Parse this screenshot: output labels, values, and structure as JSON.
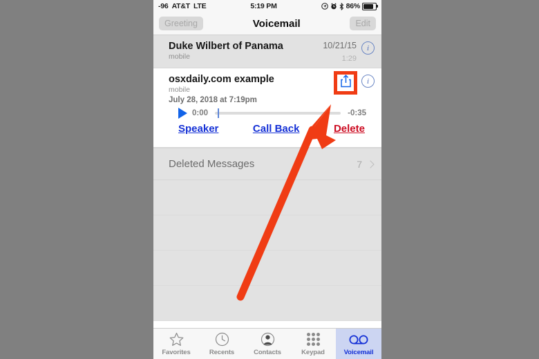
{
  "status_bar": {
    "signal": "-96",
    "carrier": "AT&T",
    "network": "LTE",
    "time": "5:19 PM",
    "battery_percent": "86%",
    "icons": [
      "location-arrow-icon",
      "alarm-clock-icon",
      "bluetooth-icon",
      "battery-icon"
    ]
  },
  "nav_bar": {
    "left_button": "Greeting",
    "title": "Voicemail",
    "right_button": "Edit"
  },
  "voicemails": [
    {
      "name": "Duke Wilbert of Panama",
      "label": "mobile",
      "date": "10/21/15",
      "duration": "1:29",
      "expanded": false
    },
    {
      "name": "osxdaily.com example",
      "label": "mobile",
      "datetime": "July 28, 2018 at 7:19pm",
      "expanded": true
    }
  ],
  "player": {
    "elapsed": "0:00",
    "remaining": "-0:35",
    "progress_percent": 2
  },
  "actions": {
    "speaker": "Speaker",
    "call_back": "Call Back",
    "delete": "Delete"
  },
  "deleted_messages": {
    "label": "Deleted Messages",
    "count": "7"
  },
  "tab_bar": {
    "tabs": [
      {
        "label": "Favorites",
        "icon": "star-icon",
        "selected": false
      },
      {
        "label": "Recents",
        "icon": "clock-icon",
        "selected": false
      },
      {
        "label": "Contacts",
        "icon": "person-icon",
        "selected": false
      },
      {
        "label": "Keypad",
        "icon": "keypad-grid-icon",
        "selected": false
      },
      {
        "label": "Voicemail",
        "icon": "voicemail-tape-icon",
        "selected": true
      }
    ]
  },
  "annotation": {
    "highlight_target": "share-button",
    "color": "#f03c14"
  },
  "colors": {
    "accent_blue": "#1430d6",
    "delete_red": "#cc0a20",
    "annotation_orange": "#f03c14",
    "list_gray": "#e2e2e2",
    "page_backdrop": "#808080"
  }
}
